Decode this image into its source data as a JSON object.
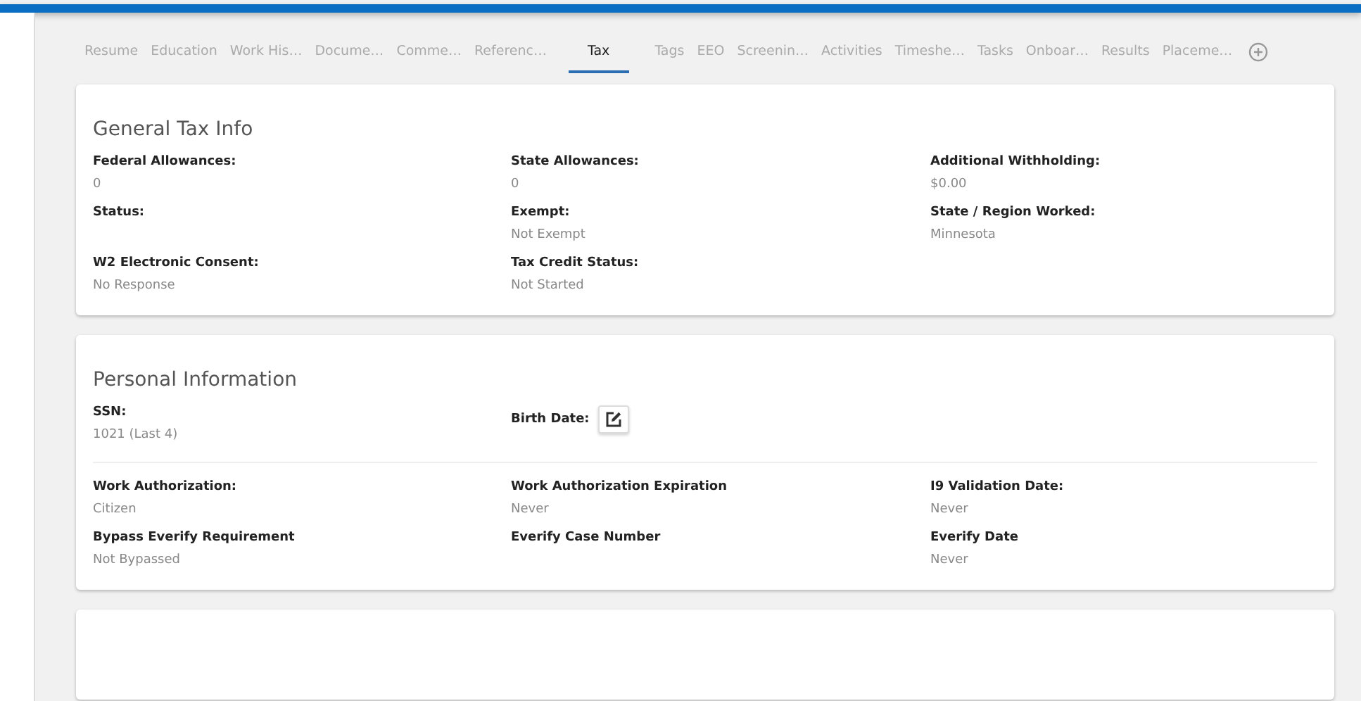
{
  "tabs": [
    {
      "label": "Resume",
      "selected": false
    },
    {
      "label": "Education",
      "selected": false
    },
    {
      "label": "Work His…",
      "selected": false
    },
    {
      "label": "Docume…",
      "selected": false
    },
    {
      "label": "Comme…",
      "selected": false
    },
    {
      "label": "Referenc…",
      "selected": false
    },
    {
      "label": "Tax",
      "selected": true
    },
    {
      "label": "Tags",
      "selected": false
    },
    {
      "label": "EEO",
      "selected": false
    },
    {
      "label": "Screenin…",
      "selected": false
    },
    {
      "label": "Activities",
      "selected": false
    },
    {
      "label": "Timeshe…",
      "selected": false
    },
    {
      "label": "Tasks",
      "selected": false
    },
    {
      "label": "Onboar…",
      "selected": false
    },
    {
      "label": "Results",
      "selected": false
    },
    {
      "label": "Placeme…",
      "selected": false
    }
  ],
  "cards": [
    {
      "title": "General Tax Info",
      "sections": [
        {
          "fields": [
            {
              "kind": "text",
              "label": "Federal Allowances:",
              "value": "0"
            },
            {
              "kind": "text",
              "label": "State Allowances:",
              "value": "0"
            },
            {
              "kind": "text",
              "label": "Additional Withholding:",
              "value": "$0.00"
            },
            {
              "kind": "text",
              "label": "Status:"
            },
            {
              "kind": "text",
              "label": "Exempt:",
              "value": "Not Exempt"
            },
            {
              "kind": "text",
              "label": "State / Region Worked:",
              "value": "Minnesota"
            },
            {
              "kind": "text",
              "label": "W2 Electronic Consent:",
              "value": "No Response"
            },
            {
              "kind": "text",
              "label": "Tax Credit Status:",
              "value": "Not Started"
            }
          ]
        }
      ]
    },
    {
      "title": "Personal Information",
      "sections": [
        {
          "fields": [
            {
              "kind": "text",
              "label": "SSN:",
              "value": "1021 (Last 4)"
            },
            {
              "kind": "edit",
              "label": "Birth Date:"
            }
          ]
        },
        {
          "fields": [
            {
              "kind": "text",
              "label": "Work Authorization:",
              "value": "Citizen"
            },
            {
              "kind": "text",
              "label": "Work Authorization Expiration",
              "value": "Never"
            },
            {
              "kind": "text",
              "label": "I9 Validation Date:",
              "value": "Never"
            },
            {
              "kind": "text",
              "label": "Bypass Everify Requirement",
              "value": "Not Bypassed"
            },
            {
              "kind": "text",
              "label": "Everify Case Number"
            },
            {
              "kind": "text",
              "label": "Everify Date",
              "value": "Never"
            }
          ]
        }
      ]
    }
  ]
}
